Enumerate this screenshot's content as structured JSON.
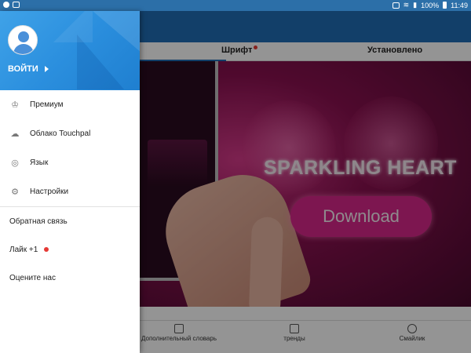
{
  "status_bar": {
    "battery": "100%",
    "time": "11:49"
  },
  "tabs": [
    {
      "label": "Шрифт",
      "has_dot": true
    },
    {
      "label": "Установлено",
      "has_dot": false
    }
  ],
  "banner": {
    "title": "SPARKLING HEART",
    "button": "Download"
  },
  "bottom_nav": [
    {
      "label": "Дополнительный словарь",
      "icon": "dictionary-icon"
    },
    {
      "label": "тренды",
      "icon": "trends-icon"
    },
    {
      "label": "Смайлик",
      "icon": "emoji-icon"
    }
  ],
  "drawer": {
    "login_label": "ВОЙТИ",
    "menu": [
      {
        "label": "Премиум",
        "icon": "crown-icon"
      },
      {
        "label": "Облако Touchpal",
        "icon": "cloud-icon"
      },
      {
        "label": "Язык",
        "icon": "globe-icon"
      },
      {
        "label": "Настройки",
        "icon": "gear-icon"
      }
    ],
    "secondary": [
      {
        "label": "Обратная связь",
        "has_dot": false
      },
      {
        "label": "Лайк +1",
        "has_dot": true
      },
      {
        "label": "Оцените нас",
        "has_dot": false
      }
    ]
  },
  "colors": {
    "status_bar": "#2c6fa8",
    "header_blue": "#1f6db5",
    "drawer_header": "#2b8fde",
    "accent_pink": "#d8278a",
    "notification_dot": "#e53935"
  }
}
